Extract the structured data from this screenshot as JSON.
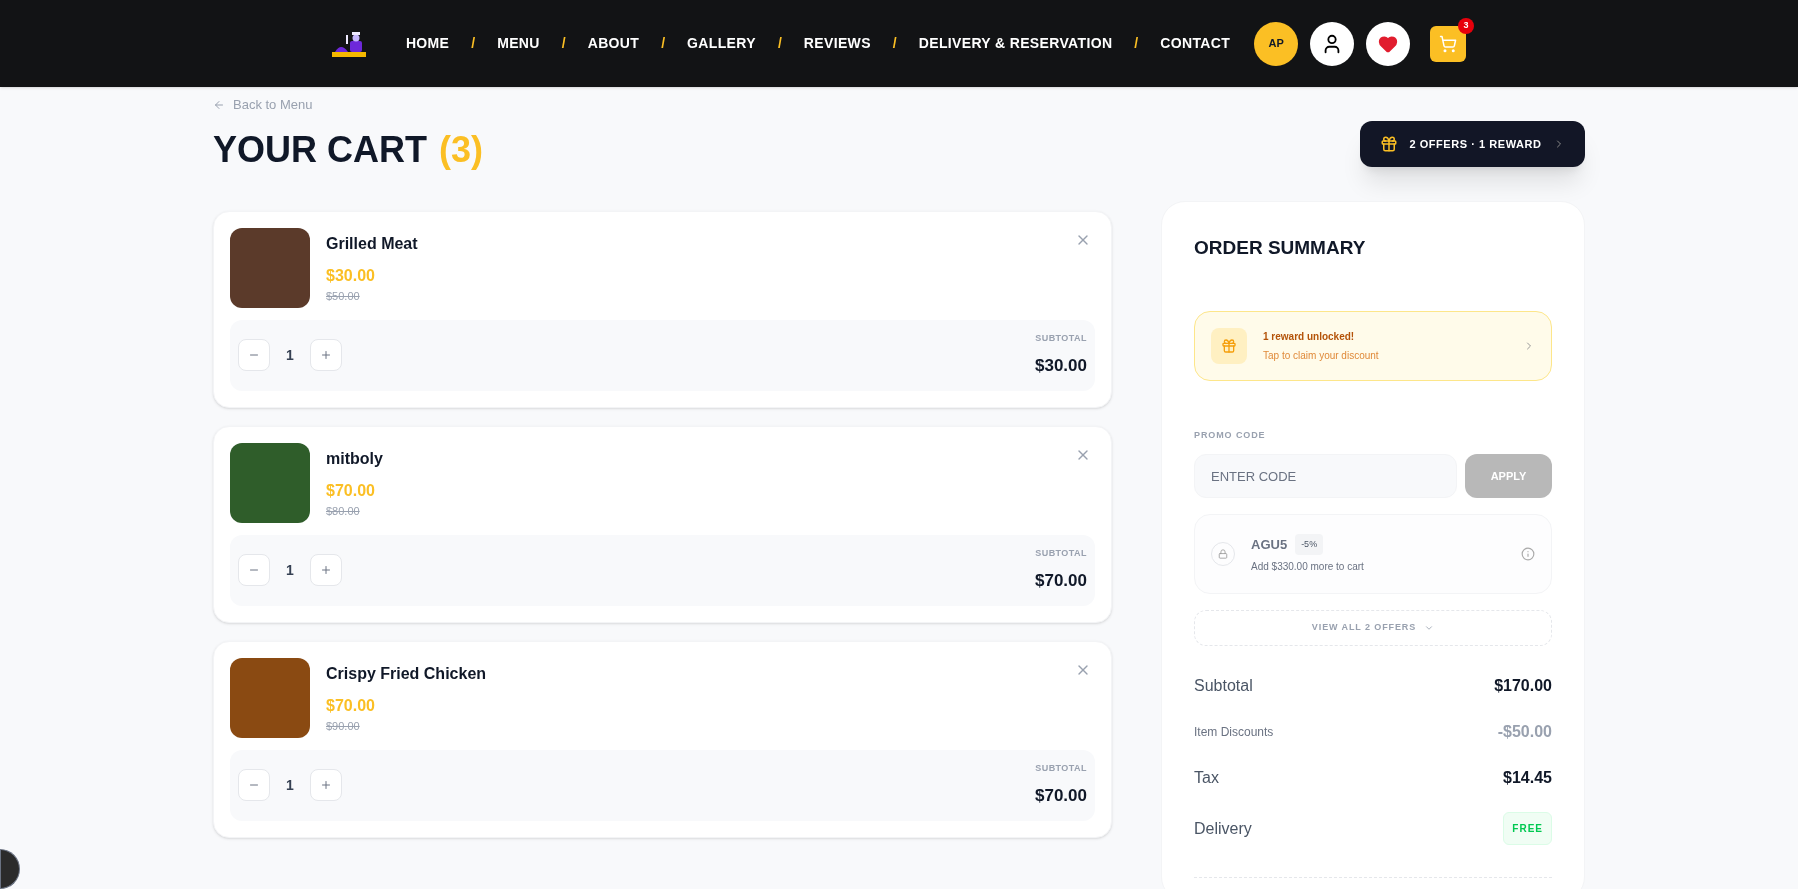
{
  "nav": {
    "avatar": "AP",
    "cart_count": "3",
    "separator": "/",
    "items": [
      {
        "label": "HOME"
      },
      {
        "label": "MENU"
      },
      {
        "label": "ABOUT"
      },
      {
        "label": "GALLERY"
      },
      {
        "label": "REVIEWS"
      },
      {
        "label": "DELIVERY & RESERVATION"
      },
      {
        "label": "CONTACT"
      }
    ]
  },
  "back_link": "Back to Menu",
  "title": "YOUR CART",
  "count": "(3)",
  "offers_button": "2 OFFERS · 1 REWARD",
  "cart_items": [
    {
      "name": "Grilled Meat",
      "price": "$30.00",
      "old_price": "$50.00",
      "quantity": "1",
      "subtotal_label": "SUBTOTAL",
      "subtotal": "$30.00"
    },
    {
      "name": "mitboly",
      "price": "$70.00",
      "old_price": "$80.00",
      "quantity": "1",
      "subtotal_label": "SUBTOTAL",
      "subtotal": "$70.00"
    },
    {
      "name": "Crispy Fried Chicken",
      "price": "$70.00",
      "old_price": "$90.00",
      "quantity": "1",
      "subtotal_label": "SUBTOTAL",
      "subtotal": "$70.00"
    }
  ],
  "summary": {
    "title": "ORDER SUMMARY",
    "reward": {
      "title": "1 reward unlocked!",
      "subtitle": "Tap to claim your discount"
    },
    "promo": {
      "label": "PROMO CODE",
      "placeholder": "ENTER CODE",
      "button": "APPLY",
      "disabled": true
    },
    "offers": [
      {
        "code": "AGU5",
        "badge": "-5%",
        "note": "Add $330.00 more to cart",
        "locked": true
      }
    ],
    "view_all": "VIEW ALL 2 OFFERS",
    "lines": [
      {
        "kind": "main",
        "label": "Subtotal",
        "value": "$170.00"
      },
      {
        "kind": "discount",
        "label": "Item Discounts",
        "value": "-$50.00"
      },
      {
        "kind": "main",
        "label": "Tax",
        "value": "$14.45"
      },
      {
        "kind": "badge",
        "label": "Delivery",
        "value": "FREE"
      }
    ]
  }
}
